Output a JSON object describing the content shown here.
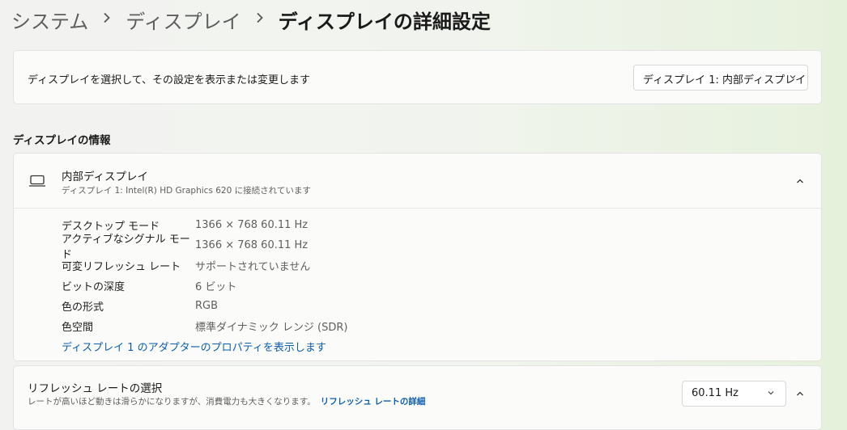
{
  "breadcrumb": {
    "items": [
      "システム",
      "ディスプレイ"
    ],
    "current": "ディスプレイの詳細設定"
  },
  "select_card": {
    "text": "ディスプレイを選択して、その設定を表示または変更します",
    "dropdown_value": "ディスプレイ 1: 内部ディスプレイ"
  },
  "section": {
    "title": "ディスプレイの情報"
  },
  "display_info": {
    "title": "内部ディスプレイ",
    "subtitle": "ディスプレイ 1: Intel(R) HD Graphics 620 に接続されています",
    "properties": [
      {
        "label": "デスクトップ モード",
        "value": "1366 × 768 60.11 Hz"
      },
      {
        "label": "アクティブなシグナル モード",
        "value": "1366 × 768 60.11 Hz"
      },
      {
        "label": "可変リフレッシュ レート",
        "value": "サポートされていません"
      },
      {
        "label": "ビットの深度",
        "value": "6 ビット"
      },
      {
        "label": "色の形式",
        "value": "RGB"
      },
      {
        "label": "色空間",
        "value": "標準ダイナミック レンジ (SDR)"
      }
    ],
    "adapter_link": "ディスプレイ 1 のアダプターのプロパティを表示します"
  },
  "refresh": {
    "title": "リフレッシュ レートの選択",
    "subtitle": "レートが高いほど動きは滑らかになりますが、消費電力も大きくなります。",
    "link": "リフレッシュ レートの詳細",
    "dropdown_value": "60.11 Hz"
  },
  "icons": {
    "breadcrumb_separator": "chevron-right-icon",
    "dropdown": "chevron-down-icon",
    "collapse": "chevron-up-icon",
    "display": "laptop-icon"
  },
  "colors": {
    "link": "#0b5eae",
    "card_background": "#fbfbfa",
    "secondary_text": "#5f5f5f"
  }
}
